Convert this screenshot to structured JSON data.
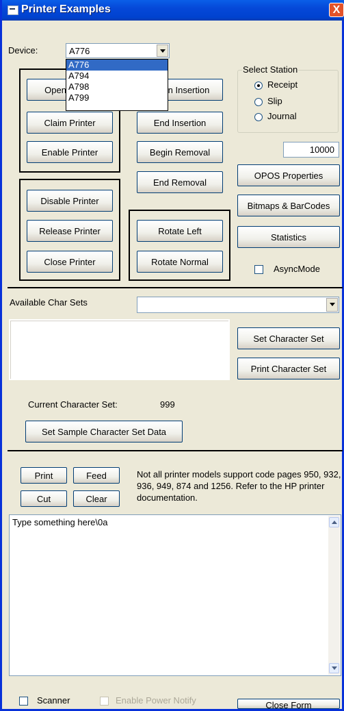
{
  "window": {
    "title": "Printer Examples",
    "close": "X"
  },
  "device": {
    "label": "Device:",
    "value": "A776",
    "options": [
      "A776",
      "A794",
      "A798",
      "A799"
    ]
  },
  "buttons": {
    "open": "Open Printer",
    "claim": "Claim Printer",
    "enable": "Enable Printer",
    "disable": "Disable Printer",
    "release": "Release Printer",
    "close": "Close Printer",
    "begin_insertion": "Begin Insertion",
    "end_insertion": "End Insertion",
    "begin_removal": "Begin Removal",
    "end_removal": "End Removal",
    "rotate_left": "Rotate Left",
    "rotate_normal": "Rotate Normal",
    "opos_properties": "OPOS Properties",
    "bitmaps_barcodes": "Bitmaps & BarCodes",
    "statistics": "Statistics",
    "set_char_set": "Set Character Set",
    "print_char_set": "Print Character Set",
    "set_sample": "Set Sample Character Set Data",
    "print": "Print",
    "feed": "Feed",
    "cut": "Cut",
    "clear": "Clear",
    "close_form": "Close Form"
  },
  "station": {
    "title": "Select Station",
    "options": [
      "Receipt",
      "Slip",
      "Journal"
    ],
    "selected": "Receipt"
  },
  "timeout_value": "10000",
  "async_mode": {
    "label": "AsyncMode",
    "checked": false
  },
  "char_sets": {
    "label": "Available Char Sets",
    "value": "",
    "current_label": "Current Character Set:",
    "current_value": "999"
  },
  "notice": "Not all printer models support code pages 950, 932, 936, 949, 874 and 1256. Refer to the HP printer documentation.",
  "print_text": "Type something here\\0a",
  "scanner": {
    "label": "Scanner",
    "checked": false
  },
  "power_notify": {
    "label": "Enable Power Notify",
    "checked": false,
    "disabled": true
  }
}
